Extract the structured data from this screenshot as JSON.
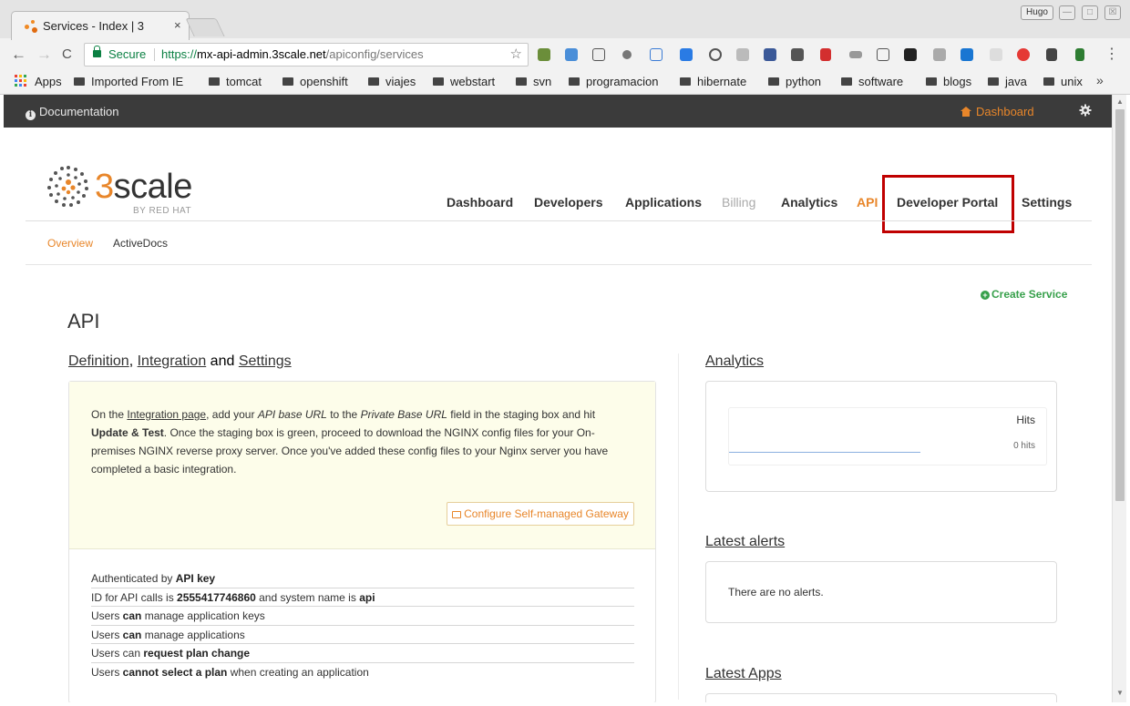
{
  "browser": {
    "tab_title": "Services - Index | 3",
    "tab_close": "×",
    "user_badge": "Hugo",
    "win_min": "—",
    "win_max": "□",
    "win_close": "☒",
    "back": "←",
    "forward": "→",
    "reload": "C",
    "secure_label": "Secure",
    "url_scheme": "https://",
    "url_host": "mx-api-admin.3scale.net",
    "url_path": "/apiconfig/services",
    "star": "☆",
    "menu": "⋮",
    "bookmarks": [
      "Apps",
      "Imported From IE",
      "tomcat",
      "openshift",
      "viajes",
      "webstart",
      "svn",
      "programacion",
      "hibernate",
      "python",
      "software",
      "blogs",
      "java",
      "unix"
    ],
    "bookmarks_more": "»",
    "colors": {
      "secure_green": "#0b8043"
    }
  },
  "topbar": {
    "documentation": "Documentation",
    "dashboard": "Dashboard"
  },
  "logo": {
    "word_three": "3",
    "word_rest": "scale",
    "sub": "BY RED HAT"
  },
  "nav": {
    "items": [
      {
        "label": "Dashboard",
        "state": "normal"
      },
      {
        "label": "Developers",
        "state": "normal"
      },
      {
        "label": "Applications",
        "state": "normal"
      },
      {
        "label": "Billing",
        "state": "disabled"
      },
      {
        "label": "Analytics",
        "state": "normal"
      },
      {
        "label": "API",
        "state": "active"
      },
      {
        "label": "Developer Portal",
        "state": "highlighted"
      },
      {
        "label": "Settings",
        "state": "normal"
      }
    ],
    "sub": [
      {
        "label": "Overview",
        "state": "active"
      },
      {
        "label": "ActiveDocs",
        "state": "normal"
      }
    ]
  },
  "main": {
    "create_service": "Create Service",
    "page_title": "API",
    "section": {
      "definition": "Definition",
      "comma": ",",
      "integration": "Integration",
      "and": "and",
      "settings": "Settings"
    },
    "info": {
      "t1": "On the ",
      "integration_link": "Integration page",
      "t2": ", add your ",
      "api_base_url": "API base URL",
      "t3": " to the ",
      "private_base_url": "Private Base URL",
      "t4": " field in the staging box and hit ",
      "update_test": "Update & Test",
      "t5": ". Once the staging box is green, proceed to download the NGINX config files for your On-premises NGINX reverse proxy server. Once you've added these config files to your Nginx server you have completed a basic integration."
    },
    "configure_button": "Configure Self-managed Gateway",
    "props": [
      {
        "a": "Authenticated by ",
        "b": "API key",
        "c": ""
      },
      {
        "a": "ID for API calls is ",
        "b": "2555417746860",
        "c": " and system name is ",
        "d": "api"
      },
      {
        "a": "Users ",
        "b": "can",
        "c": " manage application keys"
      },
      {
        "a": "Users ",
        "b": "can",
        "c": " manage applications"
      },
      {
        "a": "Users can ",
        "b": "request plan change",
        "c": ""
      },
      {
        "a": "Users ",
        "b": "cannot select a plan",
        "c": " when creating an application"
      }
    ]
  },
  "sidebar": {
    "analytics_title": "Analytics",
    "chart_hits_label": "Hits",
    "chart_zero": "0 hits",
    "alerts_title": "Latest alerts",
    "alerts_text": "There are no alerts.",
    "apps_title": "Latest Apps"
  },
  "colors": {
    "accent_orange": "#e8862a",
    "highlight_red": "#c00000",
    "create_green": "#37a04b",
    "topbar_dark": "#3b3b3b"
  }
}
